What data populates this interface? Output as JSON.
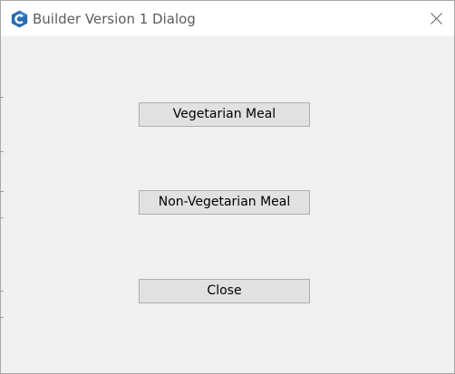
{
  "window": {
    "title": "Builder Version 1 Dialog",
    "app_icon": "csharp-c-icon",
    "close_icon": "close-icon"
  },
  "buttons": {
    "vegetarian": "Vegetarian Meal",
    "non_vegetarian": "Non-Vegetarian Meal",
    "close": "Close"
  },
  "colors": {
    "dialog_background": "#f0f0f0",
    "button_face": "#e1e1e1",
    "button_border": "#adadad",
    "icon_accent": "#2b6cb0"
  }
}
